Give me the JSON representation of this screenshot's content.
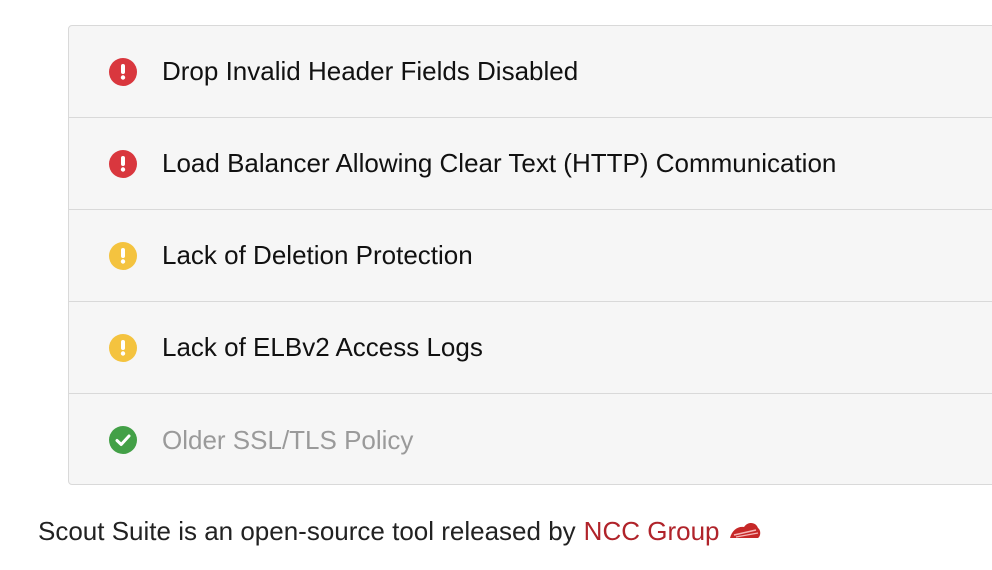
{
  "findings": [
    {
      "label": "Drop Invalid Header Fields Disabled",
      "level": "danger",
      "icon": "exclamation-circle-icon",
      "color": "#d9373e"
    },
    {
      "label": "Load Balancer Allowing Clear Text (HTTP) Communication",
      "level": "danger",
      "icon": "exclamation-circle-icon",
      "color": "#d9373e"
    },
    {
      "label": "Lack of Deletion Protection",
      "level": "warning",
      "icon": "exclamation-circle-icon",
      "color": "#f4c33f"
    },
    {
      "label": "Lack of ELBv2 Access Logs",
      "level": "warning",
      "icon": "exclamation-circle-icon",
      "color": "#f4c33f"
    },
    {
      "label": "Older SSL/TLS Policy",
      "level": "good",
      "icon": "check-circle-icon",
      "color": "#43a047"
    }
  ],
  "footer": {
    "text": "Scout Suite is an open-source tool released by",
    "link_text": "NCC Group",
    "link_color": "#b0232a",
    "logo_icon": "ncc-group-logo-icon"
  }
}
